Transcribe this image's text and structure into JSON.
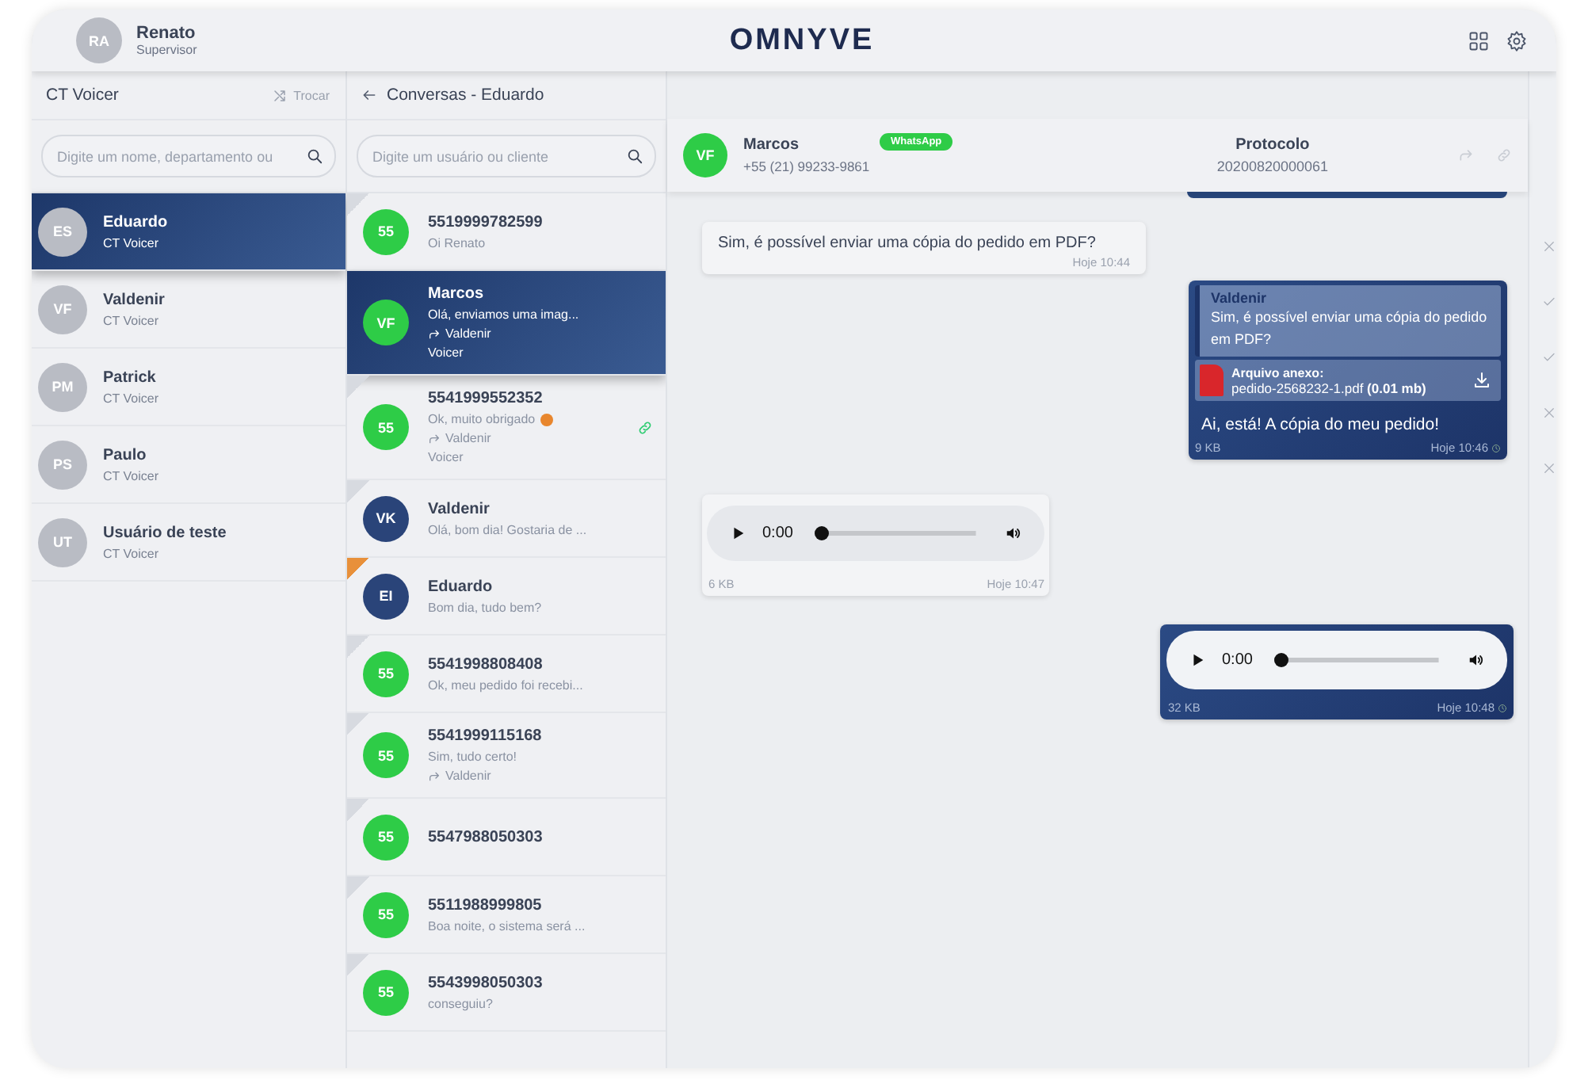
{
  "header": {
    "user": {
      "initials": "RA",
      "name": "Renato",
      "role": "Supervisor"
    },
    "logo": "OMNYVE"
  },
  "agents_panel": {
    "title": "CT Voicer",
    "switch_label": "Trocar",
    "search": {
      "placeholder": "Digite um nome, departamento ou"
    },
    "agents": [
      {
        "initials": "ES",
        "name": "Eduardo",
        "department": "CT Voicer",
        "selected": true
      },
      {
        "initials": "VF",
        "name": "Valdenir",
        "department": "CT Voicer",
        "selected": false
      },
      {
        "initials": "PM",
        "name": "Patrick",
        "department": "CT Voicer",
        "selected": false
      },
      {
        "initials": "PS",
        "name": "Paulo",
        "department": "CT Voicer",
        "selected": false
      },
      {
        "initials": "UT",
        "name": "Usuário de teste",
        "department": "CT Voicer",
        "selected": false
      }
    ]
  },
  "conversations_panel": {
    "title": "Conversas - Eduardo",
    "search": {
      "placeholder": "Digite um usuário ou cliente"
    },
    "conversations": [
      {
        "initials": "55",
        "color": "#2ecc47",
        "unread": false,
        "name": "5519999782599",
        "preview": "Oi Renato",
        "selected": false,
        "linked": false
      },
      {
        "initials": "VF",
        "color": "#2ecc47",
        "name": "Marcos",
        "preview": "Olá, enviamos uma imag...",
        "forwarded_to": "Valdenir",
        "queue": "Voicer",
        "selected": true,
        "linked": false
      },
      {
        "initials": "55",
        "color": "#2ecc47",
        "unread": false,
        "name": "5541999552352",
        "preview": "Ok, muito obrigado",
        "emoji": true,
        "forwarded_to": "Valdenir",
        "queue": "Voicer",
        "selected": false,
        "linked": true
      },
      {
        "initials": "VK",
        "color": "#2a4479",
        "unread": false,
        "name": "Valdenir",
        "preview": "Olá, bom dia! Gostaria de ...",
        "selected": false,
        "linked": false
      },
      {
        "initials": "EI",
        "color": "#2a4479",
        "unread": true,
        "name": "Eduardo",
        "preview": "Bom dia, tudo bem?",
        "selected": false,
        "linked": false
      },
      {
        "initials": "55",
        "color": "#2ecc47",
        "unread": false,
        "name": "5541998808408",
        "preview": "Ok, meu pedido foi recebi...",
        "selected": false,
        "linked": false
      },
      {
        "initials": "55",
        "color": "#2ecc47",
        "unread": false,
        "name": "5541999115168",
        "preview": "Sim, tudo certo!",
        "forwarded_to": "Valdenir",
        "selected": false,
        "linked": false
      },
      {
        "initials": "55",
        "color": "#2ecc47",
        "unread": false,
        "name": "5547988050303",
        "selected": false,
        "linked": false
      },
      {
        "initials": "55",
        "color": "#2ecc47",
        "unread": false,
        "name": "5511988999805",
        "preview": "Boa noite, o sistema será ...",
        "selected": false,
        "linked": false
      },
      {
        "initials": "55",
        "color": "#2ecc47",
        "unread": false,
        "name": "5543998050303",
        "preview": "conseguiu?",
        "selected": false,
        "linked": false
      }
    ]
  },
  "chat": {
    "contact": {
      "initials": "VF",
      "name": "Marcos",
      "phone": "+55 (21) 99233-9861",
      "channel": "WhatsApp"
    },
    "protocol": {
      "label": "Protocolo",
      "value": "20200820000061"
    },
    "messages": [
      {
        "kind": "text",
        "outgoing": false,
        "text": "Sim, é possível enviar uma cópia do pedido em PDF?",
        "time": "Hoje 10:44"
      },
      {
        "kind": "file",
        "outgoing": true,
        "reply": {
          "author": "Valdenir",
          "text": "Sim, é possível enviar uma cópia do pedido em PDF?"
        },
        "attachment": {
          "label": "Arquivo anexo:",
          "file": "pedido-2568232-1.pdf **(0.01 mb)**"
        },
        "text": "Ai, está! A cópia do meu pedido!",
        "size": "9 KB",
        "time": "Hoje 10:46"
      },
      {
        "kind": "audio",
        "outgoing": false,
        "position": "0:00",
        "level": 0,
        "size": "6 KB",
        "time": "Hoje 10:47"
      },
      {
        "kind": "audio",
        "outgoing": true,
        "position": "0:00",
        "level": 0,
        "size": "32 KB",
        "time": "Hoje 10:48"
      }
    ]
  },
  "side_marks": [
    {
      "kind": "close"
    },
    {
      "kind": "check"
    },
    {
      "kind": "check"
    },
    {
      "kind": "close"
    },
    {
      "kind": "close"
    }
  ]
}
